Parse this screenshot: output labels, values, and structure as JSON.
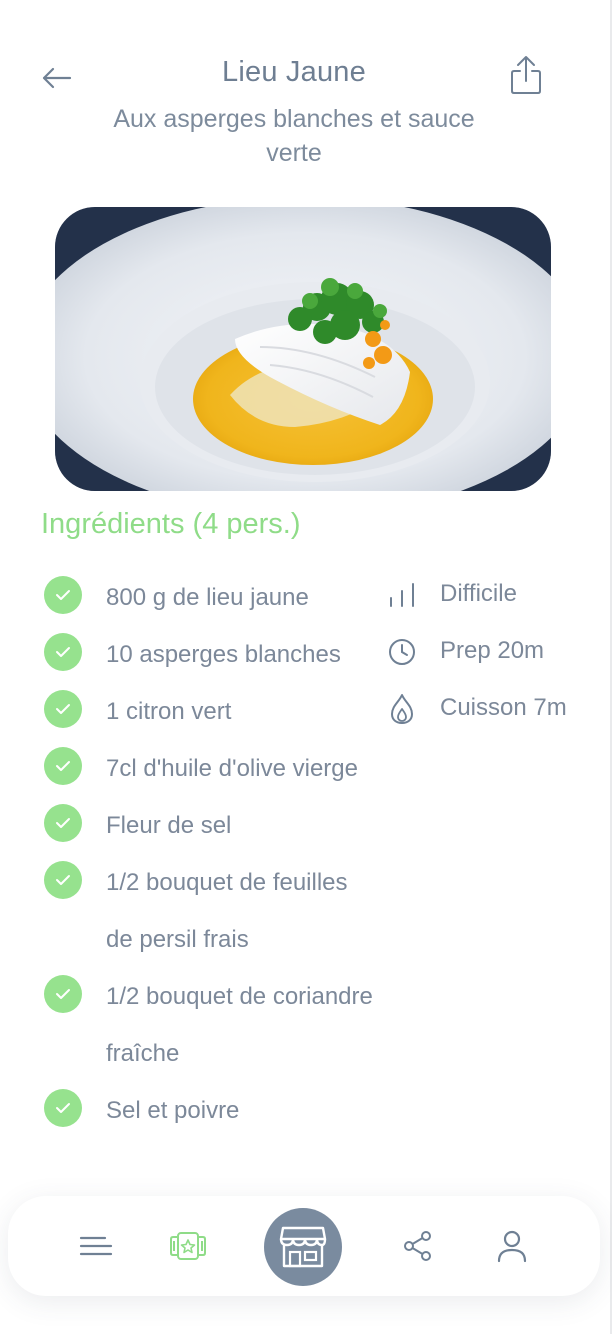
{
  "header": {
    "title": "Lieu Jaune",
    "subtitle": "Aux asperges blanches et sauce verte",
    "back_icon": "arrow-left-icon",
    "share_icon": "share-icon"
  },
  "hero_image": {
    "alt": "Lieu jaune aux asperges blanches et sauce verte"
  },
  "ingredients": {
    "title": "Ingrédients (4 pers.)",
    "items": [
      {
        "lines": [
          "800 g de lieu jaune"
        ]
      },
      {
        "lines": [
          "10 asperges blanches"
        ]
      },
      {
        "lines": [
          "1 citron vert"
        ]
      },
      {
        "lines": [
          "7cl d'huile d'olive vierge"
        ]
      },
      {
        "lines": [
          "Fleur de sel"
        ]
      },
      {
        "lines": [
          "1/2 bouquet de feuilles",
          "de persil frais"
        ]
      },
      {
        "lines": [
          "1/2 bouquet de coriandre",
          "fraîche"
        ]
      },
      {
        "lines": [
          "Sel et poivre"
        ]
      }
    ]
  },
  "meta": {
    "difficulty": "Difficile",
    "prep": "Prep 20m",
    "cooking": "Cuisson 7m"
  },
  "tabbar": {
    "items": [
      {
        "name": "menu",
        "icon": "menu-icon"
      },
      {
        "name": "favorites",
        "icon": "recipe-book-icon",
        "active": true
      },
      {
        "name": "shop",
        "icon": "store-icon",
        "center": true
      },
      {
        "name": "share",
        "icon": "share-nodes-icon"
      },
      {
        "name": "profile",
        "icon": "user-icon"
      }
    ]
  },
  "colors": {
    "accent_green": "#8fdc88",
    "check_green": "#96e28e",
    "text_gray": "#7c8899",
    "title_gray": "#6e7e92",
    "center_button": "#7a8b9f"
  }
}
